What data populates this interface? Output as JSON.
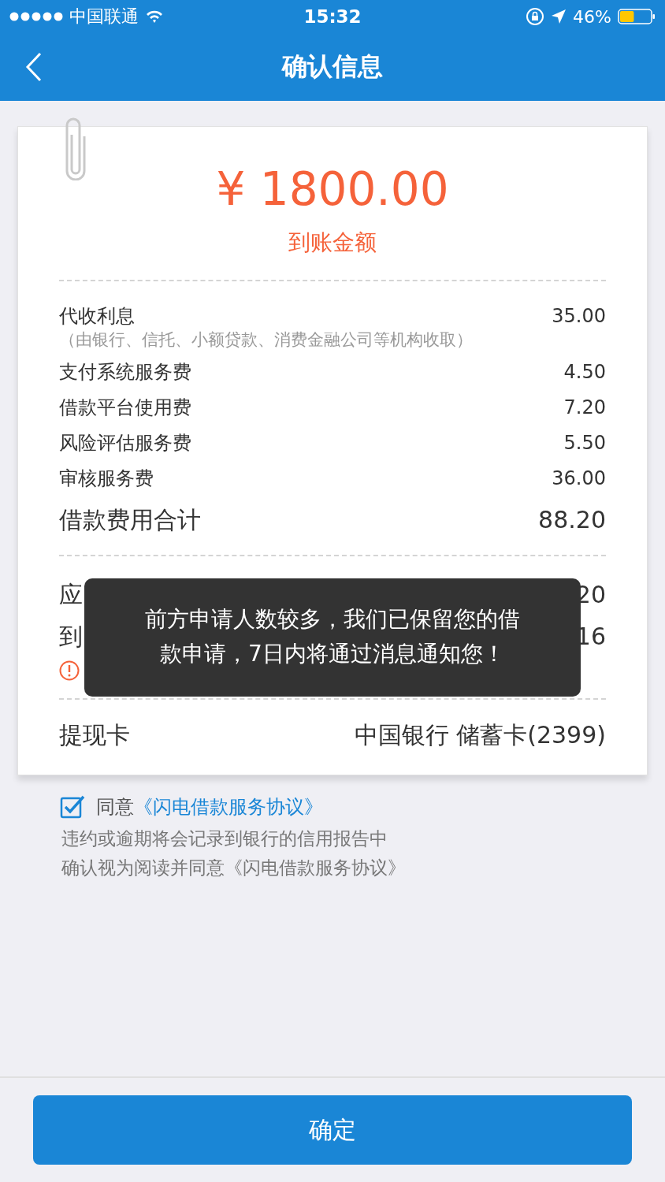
{
  "status_bar": {
    "carrier": "中国联通",
    "time": "15:32",
    "battery": "46%"
  },
  "nav": {
    "title": "确认信息"
  },
  "amount": {
    "value": "¥ 1800.00",
    "label": "到账金额"
  },
  "fees": [
    {
      "label": "代收利息",
      "note": "（由银行、信托、小额贷款、消费金融公司等机构收取）",
      "value": "35.00"
    },
    {
      "label": "支付系统服务费",
      "value": "4.50"
    },
    {
      "label": "借款平台使用费",
      "value": "7.20"
    },
    {
      "label": "风险评估服务费",
      "value": "5.50"
    },
    {
      "label": "审核服务费",
      "value": "36.00"
    }
  ],
  "fee_total": {
    "label": "借款费用合计",
    "value": "88.20"
  },
  "repayment": [
    {
      "label": "应",
      "value": "20"
    },
    {
      "label": "到",
      "value": "16"
    }
  ],
  "card": {
    "label": "提现卡",
    "value": "中国银行 储蓄卡(2399)"
  },
  "agreement": {
    "checked": true,
    "prefix": "同意",
    "link": "《闪电借款服务协议》"
  },
  "notes": [
    "违约或逾期将会记录到银行的信用报告中",
    "确认视为阅读并同意《闪电借款服务协议》"
  ],
  "toast": {
    "text": "前方申请人数较多，我们已保留您的借款申请，7日内将通过消息通知您！"
  },
  "button": {
    "label": "确定"
  }
}
